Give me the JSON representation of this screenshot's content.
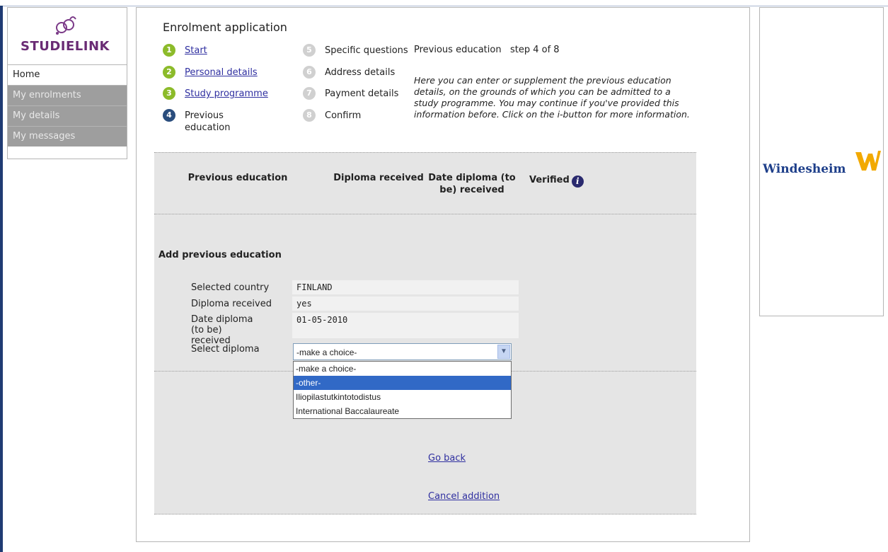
{
  "sidebar": {
    "logo_text": "STUDIELINK",
    "items": [
      {
        "label": "Home",
        "active": true
      },
      {
        "label": "My enrolments",
        "active": false
      },
      {
        "label": "My details",
        "active": false
      },
      {
        "label": "My messages",
        "active": false
      }
    ]
  },
  "main": {
    "title": "Enrolment application",
    "steps": [
      {
        "num": "1",
        "label": "Start",
        "state": "done"
      },
      {
        "num": "2",
        "label": "Personal details",
        "state": "done"
      },
      {
        "num": "3",
        "label": "Study programme",
        "state": "done"
      },
      {
        "num": "4",
        "label": "Previous education",
        "state": "current"
      },
      {
        "num": "5",
        "label": "Specific questions",
        "state": "todo"
      },
      {
        "num": "6",
        "label": "Address details",
        "state": "todo"
      },
      {
        "num": "7",
        "label": "Payment details",
        "state": "todo"
      },
      {
        "num": "8",
        "label": "Confirm",
        "state": "todo"
      }
    ],
    "info_title": "Previous education",
    "info_step": "step 4 of 8",
    "info_text": "Here you can enter or supplement the previous education details, on the grounds of which you can be admitted to a study programme. You may continue if you've provided this information before. Click on the i-button for more information.",
    "table_headers": {
      "previous_education": "Previous education",
      "diploma_received": "Diploma received",
      "date_diploma": "Date diploma (to be) received",
      "verified": "Verified"
    },
    "add_title": "Add previous education",
    "form": {
      "selected_country_label": "Selected country",
      "selected_country_value": "FINLAND",
      "diploma_received_label": "Diploma received",
      "diploma_received_value": "yes",
      "date_diploma_label": "Date diploma (to be) received",
      "date_diploma_value": "01-05-2010",
      "select_diploma_label": "Select diploma",
      "select_diploma_value": "-make a choice-",
      "options": [
        "-make a choice-",
        "-other-",
        "Iliopilastutkintotodistus",
        "International Baccalaureate"
      ],
      "highlighted_option": "-other-"
    },
    "go_back": "Go back",
    "cancel_addition": "Cancel addition"
  },
  "right": {
    "brand": "Windesheim"
  },
  "colors": {
    "brand_purple": "#6a2b74",
    "step_done": "#8cbb2a",
    "step_current": "#2a4d7d",
    "step_todo": "#d0d0d0",
    "link": "#2f2fa0",
    "highlight": "#3169c6"
  }
}
